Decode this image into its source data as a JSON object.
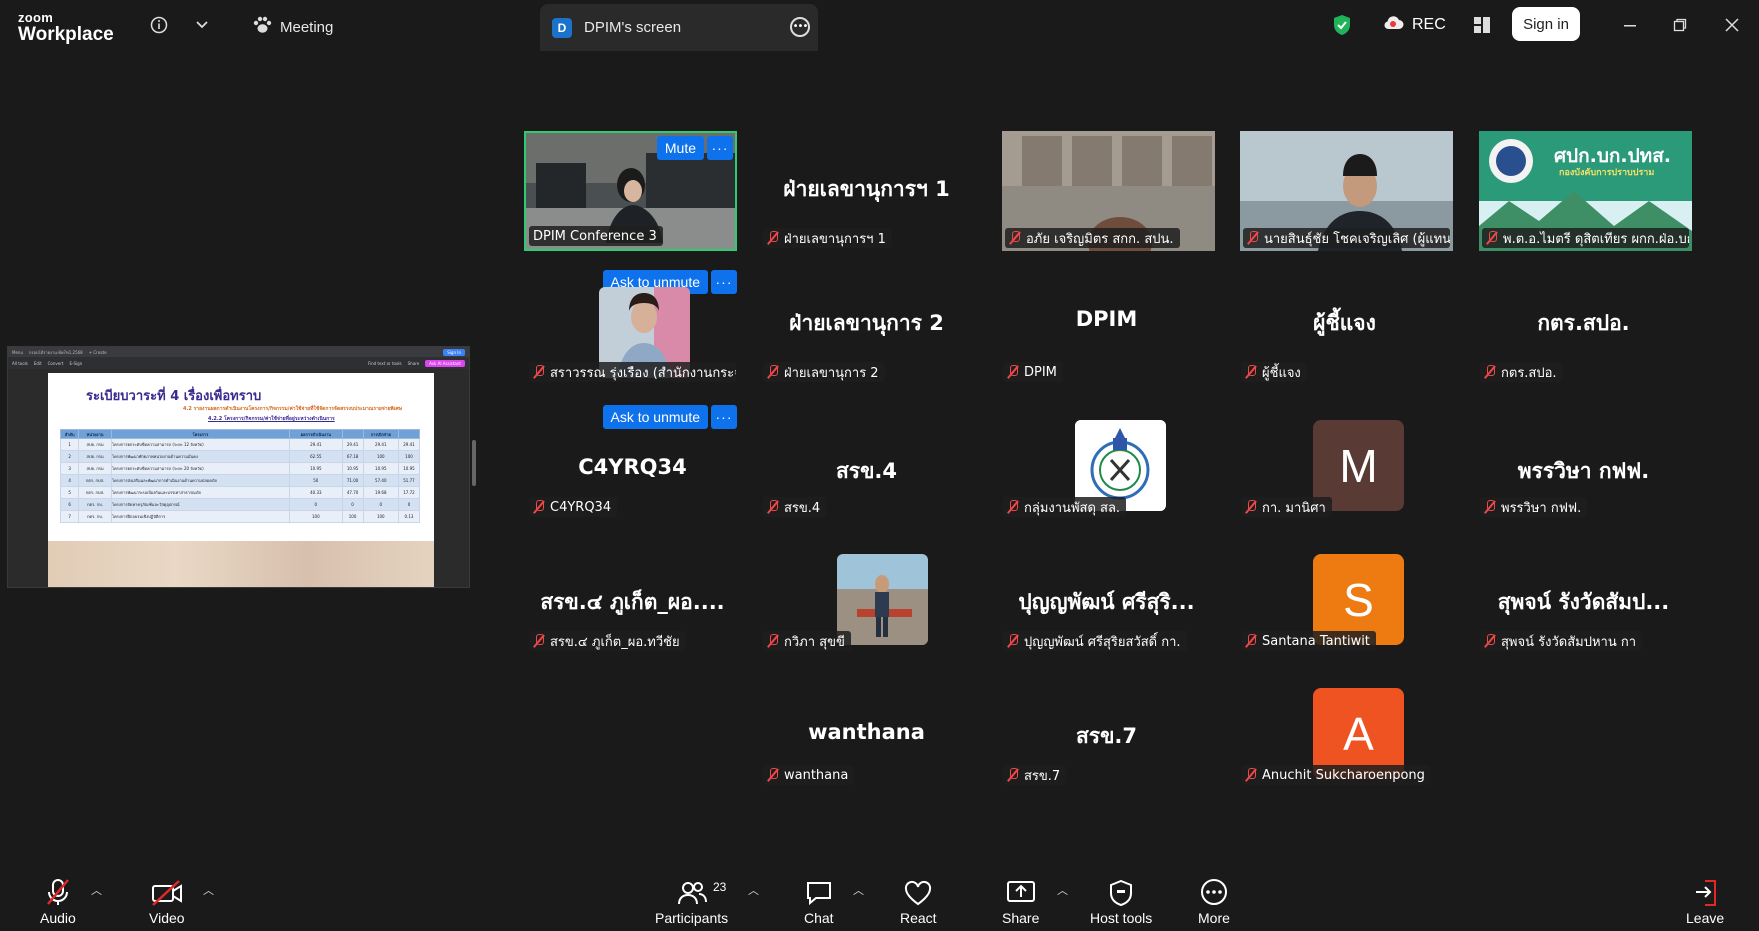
{
  "app": {
    "brand_line1": "zoom",
    "brand_line2": "Workplace"
  },
  "topbar": {
    "meeting_label": "Meeting",
    "share_tab_badge": "D",
    "share_tab_title": "DPIM's screen",
    "rec_label": "REC",
    "signin_label": "Sign in"
  },
  "shared_screen": {
    "menu_label": "Menu",
    "tab1": "กรอบโต้รายงาน-8พ7ท1.2568",
    "create_label": "+ Create",
    "toolbar_items": [
      "All tools",
      "Edit",
      "Convert",
      "E-Sign"
    ],
    "find_label": "Find text or tools",
    "share_label": "Share",
    "sign_in": "Sign In",
    "ai_label": "Ask AI Assistant",
    "heading": "ระเบียบวาระที่ 4  เรื่องเพื่อทราบ",
    "sub1": "4.2 รายงานผลการดำเนินงานโครงการ/กิจกรรม/ค่าใช้จ่ายที่ใช้จัดการจัดสรรงบประมาณรายจ่ายพิเศษ",
    "sub2": "4.2.2 โครงการ/กิจกรรม/ค่าใช้จ่ายที่อยู่ระหว่างดำเนินการ",
    "table_headers": [
      "ลำดับ",
      "หน่วยงาน",
      "โครงการ",
      "ผลการดำเนินงาน",
      "",
      "การเบิกจ่าย",
      ""
    ],
    "table_rows": [
      [
        "1",
        "สปย. กรม",
        "โครงการยกระดับขีดความสามารถ (ระยะ 12 จังหวัด)",
        "29.41",
        "29.41",
        "29.41",
        "29.41"
      ],
      [
        "2",
        "สปย. กรม",
        "โครงการพัฒนาศักยภาพหน่วยงานด้านความมั่นคง",
        "62.55",
        "67.18",
        "100",
        "100"
      ],
      [
        "3",
        "สปย. กรม",
        "โครงการยกระดับขีดความสามารถ (ระยะ 20 จังหวัด)",
        "10.95",
        "10.95",
        "10.95",
        "10.95"
      ],
      [
        "4",
        "กตร. กบส.",
        "โครงการส่งเสริมและพัฒนาการดำเนินงานด้านความปลอดภัย",
        "50",
        "71.00",
        "57.40",
        "51.77"
      ],
      [
        "5",
        "กตร. กบส.",
        "โครงการพัฒนาระบบป้องกันและบรรเทาสาธารณภัย",
        "40.33",
        "47.70",
        "19.68",
        "17.72"
      ],
      [
        "6",
        "กตร. กบ.",
        "โครงการจัดหาครุภัณฑ์และวัสดุอุปกรณ์",
        "0",
        "0",
        "0",
        "0"
      ],
      [
        "7",
        "กตร. กบ.",
        "โครงการฝึกอบรมเชิงปฏิบัติการ",
        "100",
        "100",
        "100",
        "0.13"
      ]
    ]
  },
  "gallery": {
    "mute_label": "Mute",
    "ask_unmute_label": "Ask to unmute",
    "tiles": [
      {
        "name": "DPIM Conference 3"
      },
      {
        "name": "ฝ่ายเลขานุการฯ 1",
        "display": "ฝ่ายเลขานุการฯ 1"
      },
      {
        "name": "อภัย เจริญมิตร สกก. สปน."
      },
      {
        "name": "นายสินธุ์ชัย โชคเจริญเลิศ (ผู้แทน ส..."
      },
      {
        "name": "พ.ต.อ.ไมตรี ดุสิตเทียร ผกก.ฝ่อ.บก.ปทส.",
        "banner": "ศปก.บก.ปทส.",
        "banner_sub": "กองบังคับการปราบปราม"
      },
      {
        "name": "สราวรรณ รุ่งเรือง (สำนักงานกระจายอ..."
      },
      {
        "name": "ฝ่ายเลขานุการ 2",
        "display": "ฝ่ายเลขานุการ 2"
      },
      {
        "name": "DPIM",
        "display": "DPIM"
      },
      {
        "name": "ผู้ชี้แจง",
        "display": "ผู้ชี้แจง"
      },
      {
        "name": "กตร.สปอ.",
        "display": "กตร.สปอ."
      },
      {
        "name": "C4YRQ34",
        "display": "C4YRQ34"
      },
      {
        "name": "สรข.4",
        "display": "สรข.4"
      },
      {
        "name": "กลุ่มงานพัสดุ สล."
      },
      {
        "name": "กา. มานิศา",
        "initial": "M",
        "color": "#5a3a34"
      },
      {
        "name": "พรรวิษา กฟฟ.",
        "display": "พรรวิษา กฟฟ."
      },
      {
        "name": "สรข.๔ ภูเก็ต_ผอ.ทวีชัย",
        "display": "สรข.๔ ภูเก็ต_ผอ...."
      },
      {
        "name": "กวิภา สุขขี"
      },
      {
        "name": "ปุญญพัฒน์ ศรีสุริยสวัสดิ์ กา.",
        "display": "ปุญญพัฒน์ ศรีสุริ..."
      },
      {
        "name": "Santana Tantiwit",
        "initial": "S",
        "color": "#ee7a12"
      },
      {
        "name": "สุพจน์ รังวัดสัมปหาน กา",
        "display": "สุพจน์ รังวัดสัมป..."
      },
      {
        "name": "wanthana",
        "display": "wanthana"
      },
      {
        "name": "สรข.7",
        "display": "สรข.7"
      },
      {
        "name": "Anuchit Sukcharoenpong",
        "initial": "A",
        "color": "#ef5322"
      }
    ]
  },
  "bottombar": {
    "audio": "Audio",
    "video": "Video",
    "participants": "Participants",
    "participants_count": "23",
    "chat": "Chat",
    "react": "React",
    "share": "Share",
    "host_tools": "Host tools",
    "more": "More",
    "leave": "Leave"
  },
  "colors": {
    "accent": "#0e72ed",
    "active_border": "#2ecc71",
    "muted": "#f04848",
    "leave": "#e02828"
  }
}
